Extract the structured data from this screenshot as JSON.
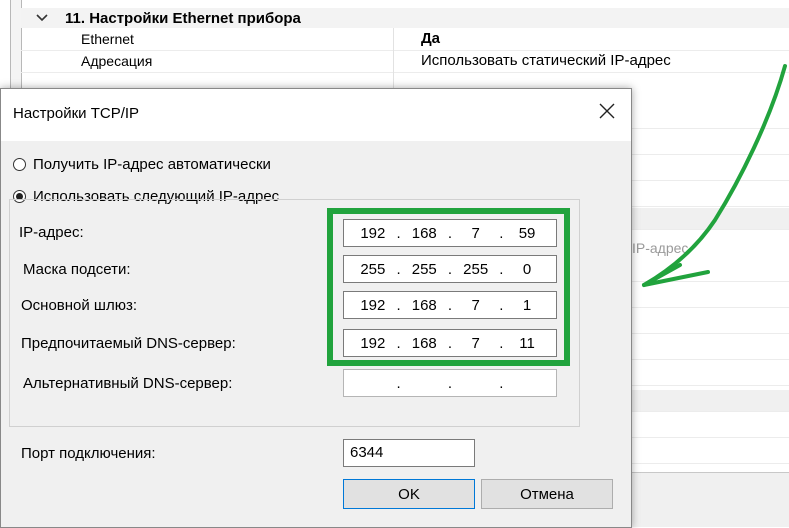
{
  "property_grid": {
    "category": {
      "title": "11. Настройки Ethernet прибора"
    },
    "rows": [
      {
        "name": "Ethernet",
        "value": "Да"
      },
      {
        "name": "Адресация",
        "value": "Использовать статический IP-адрес"
      }
    ],
    "partial_value": "IP-адрес"
  },
  "dialog": {
    "title": "Настройки TCP/IP",
    "radio_auto": "Получить IP-адрес автоматически",
    "radio_static": "Использовать следующий IP-адрес",
    "fields": {
      "ip": {
        "label": "IP-адрес:",
        "octets": [
          "192",
          "168",
          "7",
          "59"
        ]
      },
      "mask": {
        "label": "Маска подсети:",
        "octets": [
          "255",
          "255",
          "255",
          "0"
        ]
      },
      "gateway": {
        "label": "Основной шлюз:",
        "octets": [
          "192",
          "168",
          "7",
          "1"
        ]
      },
      "dns1": {
        "label": "Предпочитаемый DNS-сервер:",
        "octets": [
          "192",
          "168",
          "7",
          "11"
        ]
      },
      "dns2": {
        "label": "Альтернативный DNS-сервер:",
        "octets": [
          "",
          "",
          "",
          ""
        ]
      }
    },
    "port": {
      "label": "Порт подключения:",
      "value": "6344"
    },
    "ok_label": "OK",
    "cancel_label": "Отмена"
  },
  "annotation": {
    "highlight_color": "#21a33d",
    "arrow_color": "#21a33d"
  }
}
